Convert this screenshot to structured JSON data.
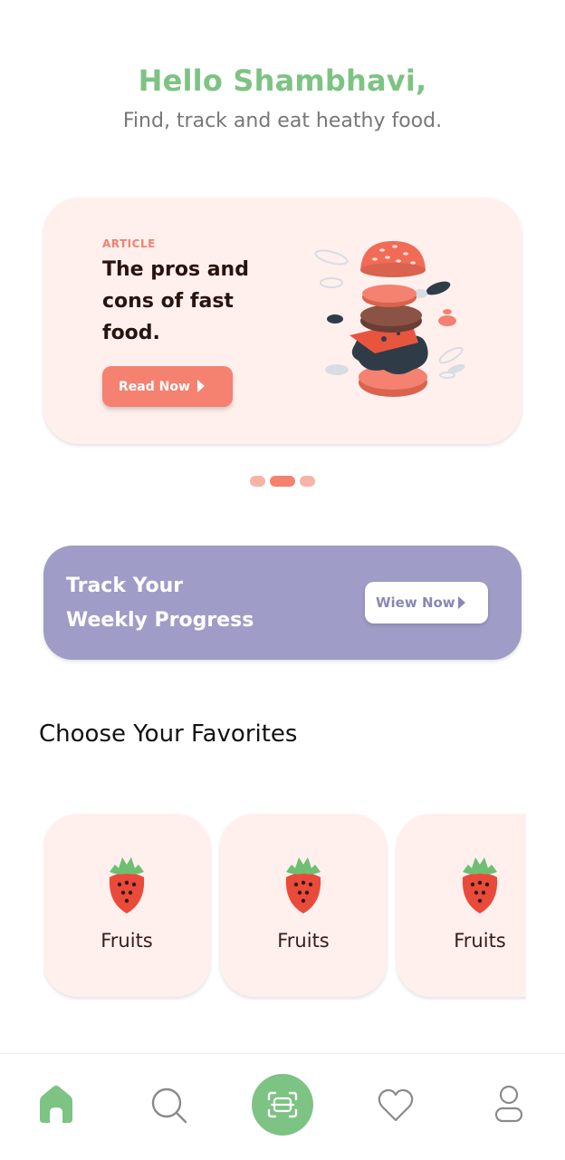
{
  "header": {
    "greeting": "Hello Shambhavi,",
    "subtitle": "Find, track and eat heathy food."
  },
  "article": {
    "tag": "ARTICLE",
    "title": "The pros and cons of fast food.",
    "button_label": "Read Now",
    "image_icon": "burger-illustration"
  },
  "carousel": {
    "dots": 3,
    "active_index": 1
  },
  "progress": {
    "title_line1": "Track Your",
    "title_line2": "Weekly Progress",
    "button_label": "Wiew Now"
  },
  "favorites": {
    "title": "Choose Your Favorites",
    "items": [
      {
        "label": "Fruits",
        "icon": "strawberry-icon"
      },
      {
        "label": "Fruits",
        "icon": "strawberry-icon"
      },
      {
        "label": "Fruits",
        "icon": "strawberry-icon"
      }
    ]
  },
  "nav": {
    "items": [
      {
        "icon": "home-icon",
        "active": true
      },
      {
        "icon": "search-icon",
        "active": false
      },
      {
        "icon": "scan-icon",
        "active": false
      },
      {
        "icon": "heart-icon",
        "active": false
      },
      {
        "icon": "profile-icon",
        "active": false
      }
    ]
  },
  "colors": {
    "accent_green": "#7dc383",
    "accent_coral": "#f58170",
    "card_pink": "#fff0ee",
    "progress_purple": "#9f9cc7"
  }
}
